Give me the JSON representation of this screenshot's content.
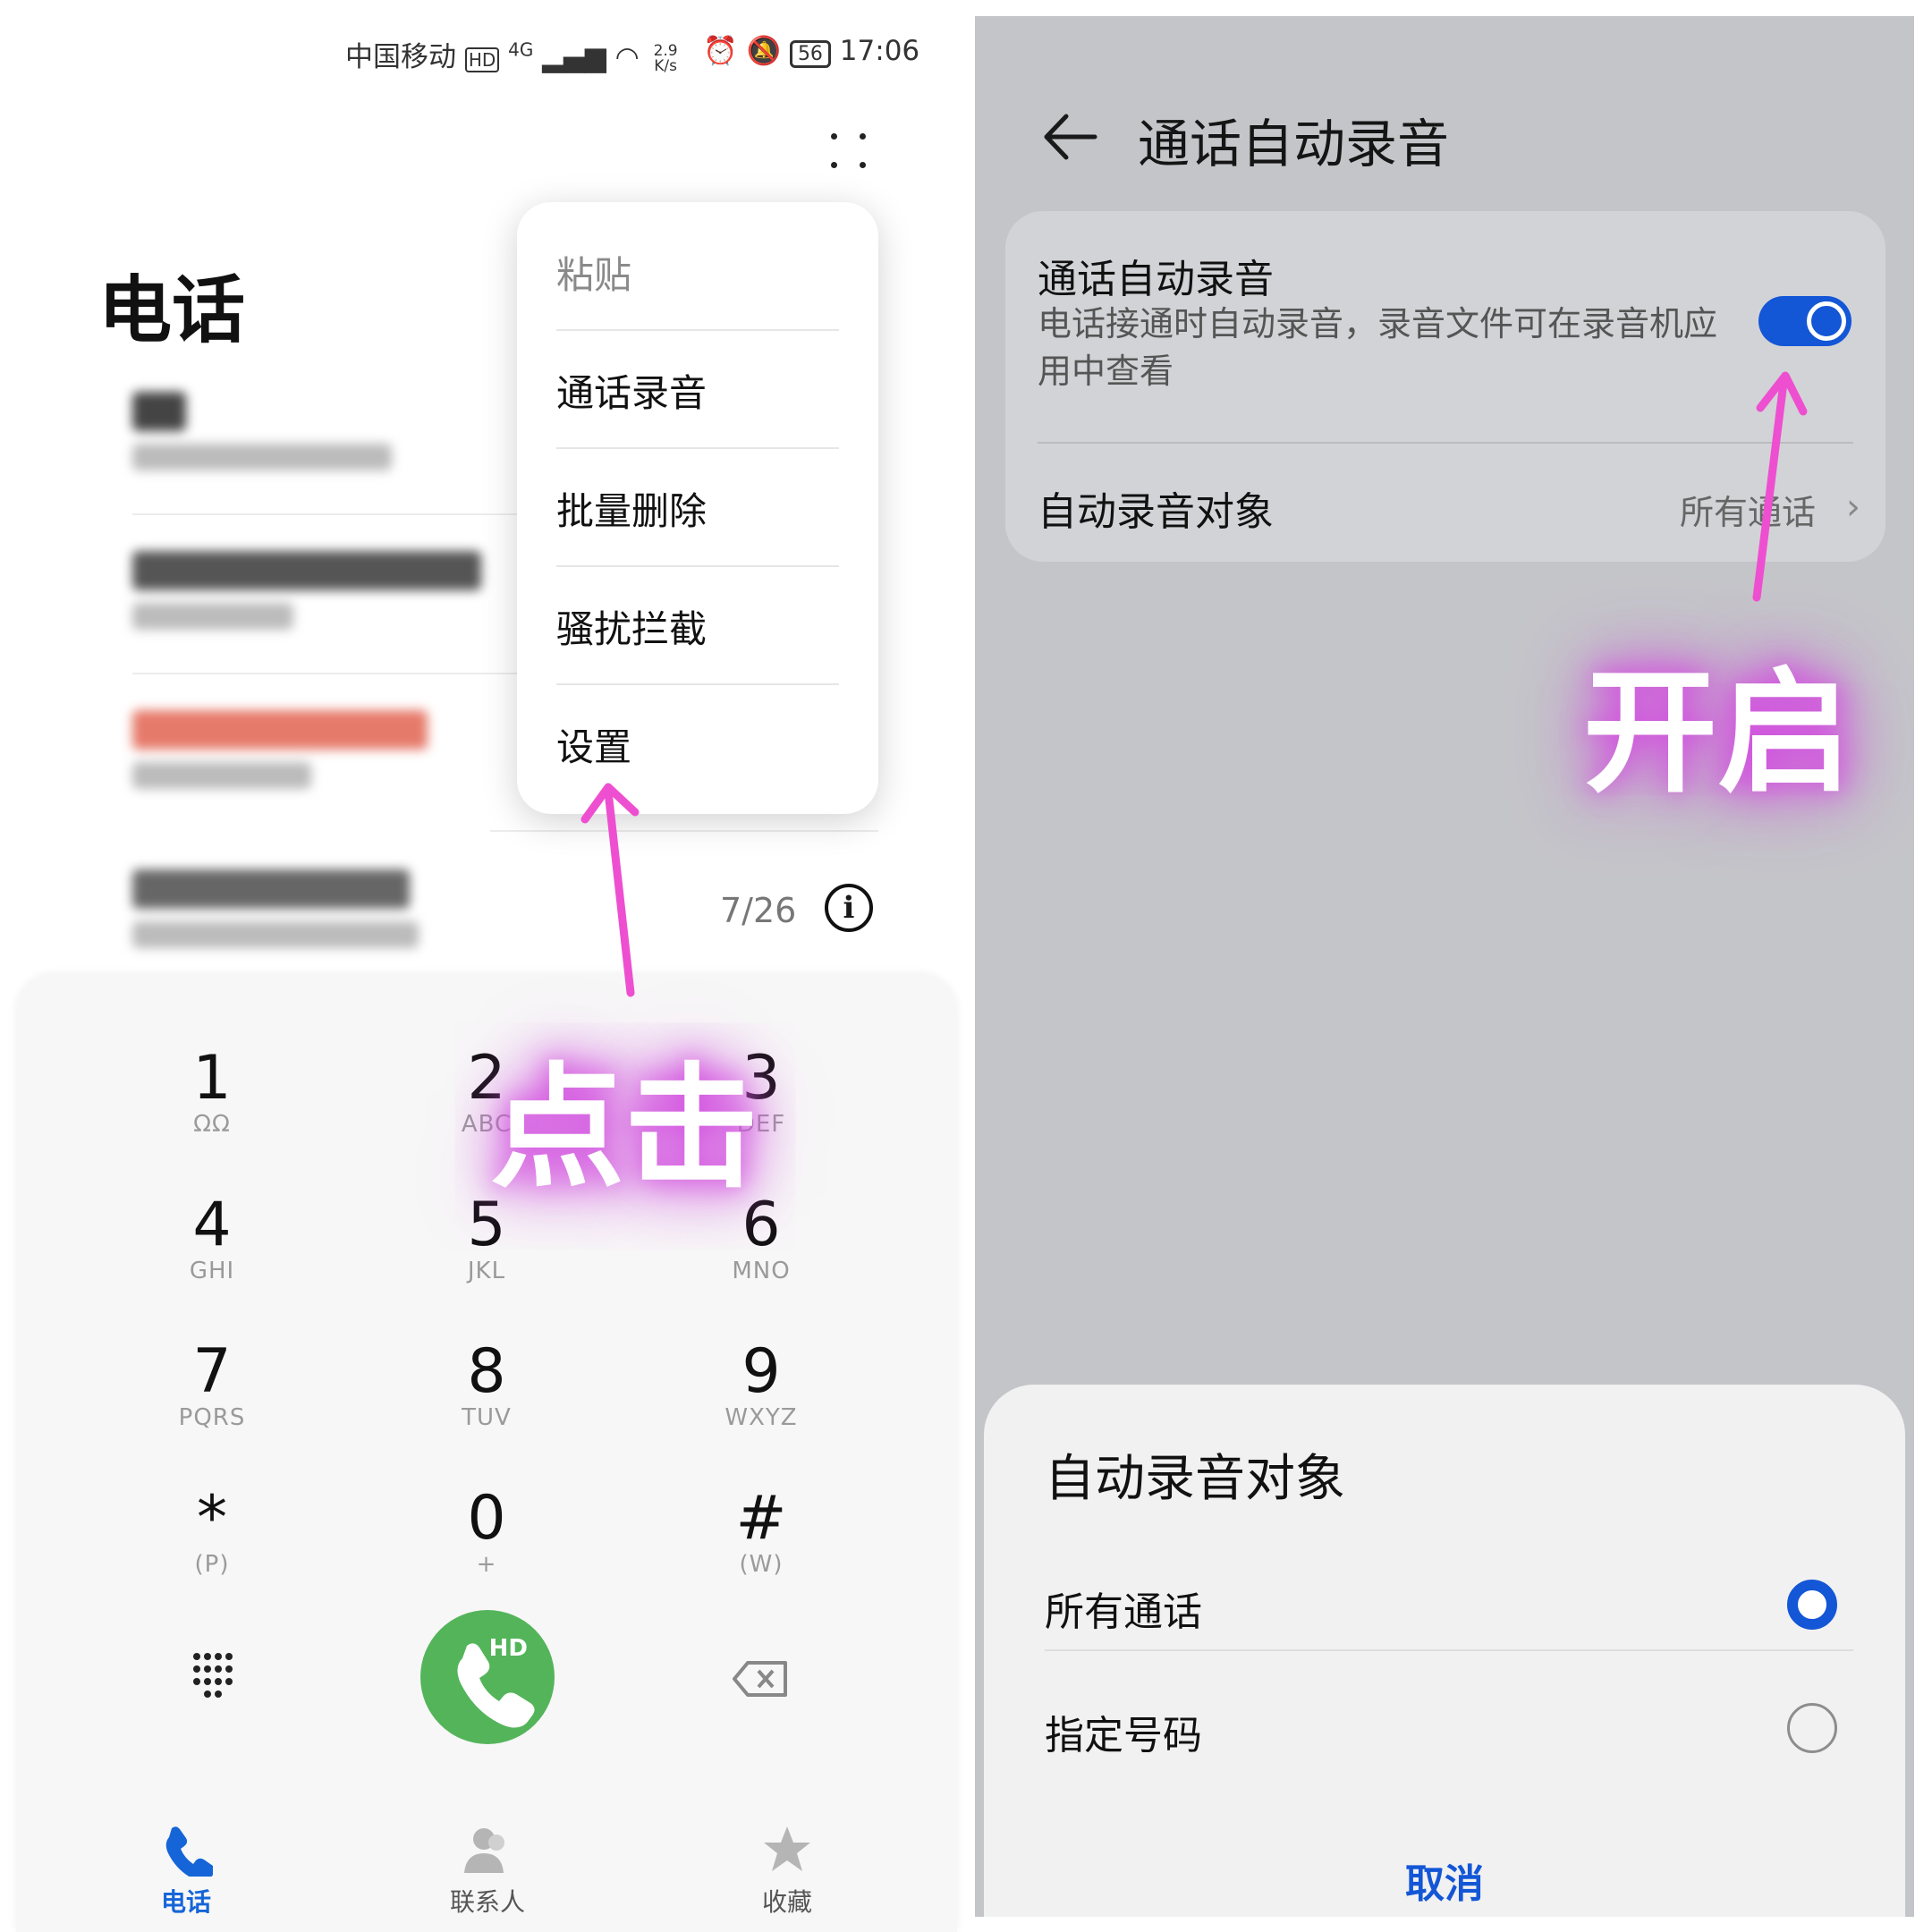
{
  "left": {
    "status": {
      "carrier": "中国移动",
      "network": "4G",
      "speed_value": "2.9",
      "speed_unit": "K/s",
      "battery": "56",
      "time": "17:06"
    },
    "title": "电话",
    "menu": {
      "items": [
        "粘贴",
        "通话录音",
        "批量删除",
        "骚扰拦截",
        "设置"
      ]
    },
    "recents": {
      "last_date": "7/26"
    },
    "dialpad": {
      "keys": [
        {
          "digit": "1",
          "letters": "ΩΩ"
        },
        {
          "digit": "2",
          "letters": "ABC"
        },
        {
          "digit": "3",
          "letters": "DEF"
        },
        {
          "digit": "4",
          "letters": "GHI"
        },
        {
          "digit": "5",
          "letters": "JKL"
        },
        {
          "digit": "6",
          "letters": "MNO"
        },
        {
          "digit": "7",
          "letters": "PQRS"
        },
        {
          "digit": "8",
          "letters": "TUV"
        },
        {
          "digit": "9",
          "letters": "WXYZ"
        },
        {
          "digit": "*",
          "letters": "(P)"
        },
        {
          "digit": "0",
          "letters": "+"
        },
        {
          "digit": "#",
          "letters": "(W)"
        }
      ],
      "call_badge": "HD"
    },
    "tabs": [
      {
        "label": "电话",
        "icon": "phone-icon",
        "active": true
      },
      {
        "label": "联系人",
        "icon": "contacts-icon",
        "active": false
      },
      {
        "label": "收藏",
        "icon": "star-icon",
        "active": false
      }
    ],
    "annotation": "点击"
  },
  "right": {
    "title": "通话自动录音",
    "setting": {
      "title": "通话自动录音",
      "description": "电话接通时自动录音，录音文件可在录音机应用中查看",
      "enabled": true
    },
    "target_row": {
      "label": "自动录音对象",
      "value": "所有通话"
    },
    "annotation": "开启",
    "sheet": {
      "title": "自动录音对象",
      "options": [
        {
          "label": "所有通话",
          "selected": true
        },
        {
          "label": "指定号码",
          "selected": false
        }
      ],
      "cancel": "取消"
    }
  },
  "colors": {
    "accent": "#1356d6",
    "call_green": "#54b45a",
    "annotation_glow": "#d34fe0",
    "annotation_arrow": "#ee4fd0"
  }
}
